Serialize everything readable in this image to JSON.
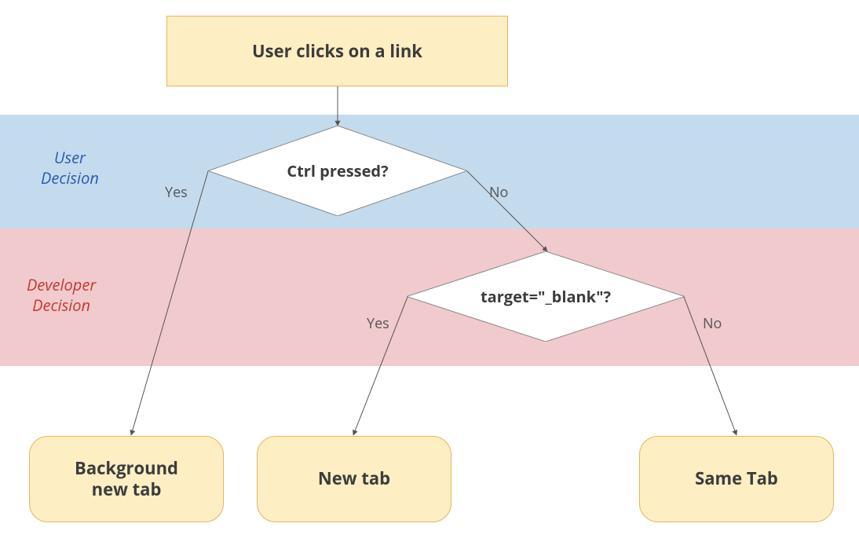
{
  "bands": {
    "user_label": "User\nDecision",
    "dev_label": "Developer\nDecision"
  },
  "nodes": {
    "start": "User clicks on a link",
    "decision1": "Ctrl pressed?",
    "decision2": "target=\"_blank\"?",
    "end_bg": "Background\nnew tab",
    "end_new": "New tab",
    "end_same": "Same Tab"
  },
  "edges": {
    "d1_yes": "Yes",
    "d1_no": "No",
    "d2_yes": "Yes",
    "d2_no": "No"
  }
}
